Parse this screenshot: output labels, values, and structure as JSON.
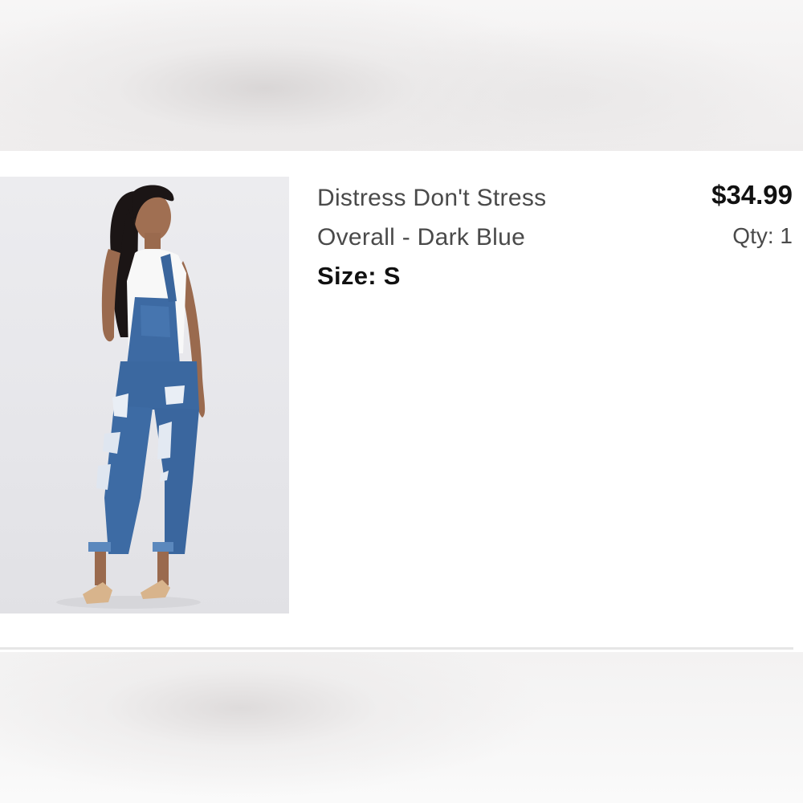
{
  "cart_item": {
    "image_alt": "Distress Don't Stress Overall - Dark Blue",
    "title_line1": "Distress Don't Stress",
    "title_line2": "Overall - Dark Blue",
    "size_label": "Size:",
    "size_value": "S",
    "price": "$34.99",
    "qty_label": "Qty:",
    "qty_value": "1"
  },
  "colors": {
    "title_text": "#4a4a4a",
    "emphasis_text": "#111111",
    "denim": "#3f6ea8",
    "divider": "#e6e6e6"
  }
}
